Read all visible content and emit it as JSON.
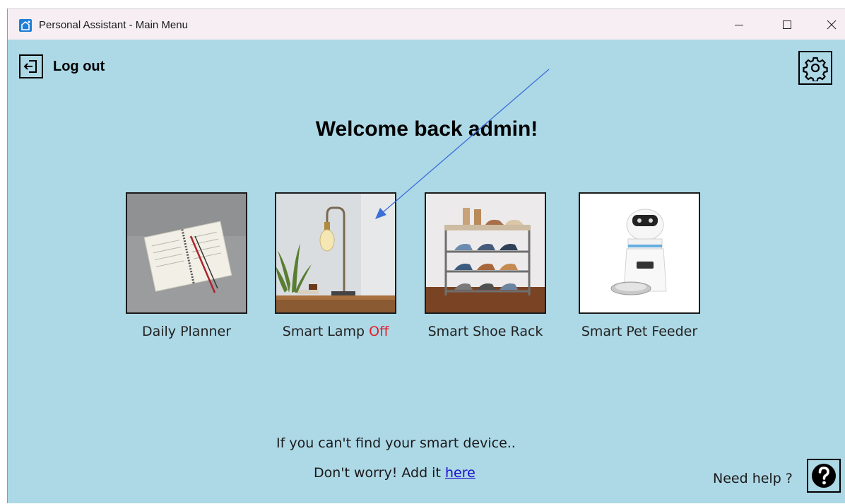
{
  "window": {
    "title": "Personal Assistant - Main Menu",
    "icons": {
      "app": "home-app-icon",
      "minimize": "minimize-icon",
      "maximize": "maximize-icon",
      "close": "close-icon"
    }
  },
  "header": {
    "logout_label": "Log out",
    "logout_icon": "logout-icon",
    "settings_icon": "gear-icon"
  },
  "main": {
    "welcome": "Welcome back admin!",
    "devices": [
      {
        "label": "Daily Planner",
        "image": "planner-image",
        "status": ""
      },
      {
        "label": "Smart Lamp",
        "image": "lamp-image",
        "status": "Off"
      },
      {
        "label": "Smart Shoe Rack",
        "image": "shoe-rack-image",
        "status": ""
      },
      {
        "label": "Smart Pet Feeder",
        "image": "pet-feeder-image",
        "status": ""
      }
    ]
  },
  "footer": {
    "line1": "If you can't find your smart device..",
    "line2_prefix": "Don't worry! Add it ",
    "line2_link": "here",
    "need_help": "Need help ?",
    "help_icon": "question-icon"
  },
  "colors": {
    "background": "#add8e6",
    "titlebar": "#f6eef2",
    "status_off": "#e0202a",
    "link": "#1a0dcc",
    "annotation_arrow": "#3a6fd8"
  }
}
